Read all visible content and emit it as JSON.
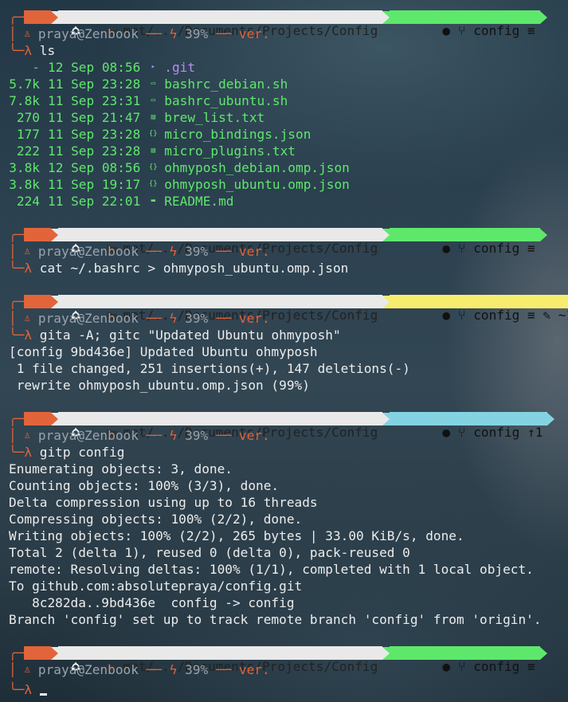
{
  "colors": {
    "accent_orange": "#e2643a",
    "git_clean": "#5ee86b",
    "git_dirty": "#f6ec6e",
    "git_ahead": "#84d3e3",
    "path_bg": "#e9e9e9",
    "file_green": "#5ee86b",
    "dir_purple": "#b98bf3"
  },
  "prompt": {
    "path": "mnt/.../Documents/Projects/Config",
    "user_host": "praya@Zenbook",
    "battery": "39%",
    "ver": "ver.",
    "lambda": "λ",
    "user_icon": "user-icon",
    "bolt_icon": "bolt-icon",
    "folder_icon": "folder-icon",
    "os_icon": "ubuntu-icon",
    "git_icon": "github-icon",
    "branch_icon": "branch-icon"
  },
  "blocks": [
    {
      "branch": "config",
      "status": "≡",
      "command": "ls"
    },
    {
      "branch": "config",
      "status": "≡",
      "command": "cat ~/.bashrc > ohmyposh_ubuntu.omp.json"
    },
    {
      "branch": "config",
      "status": "≡",
      "changes": "~1",
      "command": "gita -A; gitc \"Updated Ubuntu ohmyposh\""
    },
    {
      "branch": "config",
      "status": "↑1",
      "command": "gitp config"
    },
    {
      "branch": "config",
      "status": "≡",
      "command": ""
    }
  ],
  "ls_output": [
    {
      "size": "-",
      "date": "12 Sep 08:56",
      "icon": "folder-icon",
      "name": ".git"
    },
    {
      "size": "5.7k",
      "date": "11 Sep 23:28",
      "icon": "terminal-file-icon",
      "name": "bashrc_debian.sh"
    },
    {
      "size": "7.8k",
      "date": "11 Sep 23:31",
      "icon": "terminal-file-icon",
      "name": "bashrc_ubuntu.sh"
    },
    {
      "size": "270",
      "date": "11 Sep 21:47",
      "icon": "text-file-icon",
      "name": "brew_list.txt"
    },
    {
      "size": "177",
      "date": "11 Sep 23:28",
      "icon": "json-file-icon",
      "name": "micro_bindings.json"
    },
    {
      "size": "222",
      "date": "11 Sep 23:28",
      "icon": "text-file-icon",
      "name": "micro_plugins.txt"
    },
    {
      "size": "3.8k",
      "date": "12 Sep 08:56",
      "icon": "json-file-icon",
      "name": "ohmyposh_debian.omp.json"
    },
    {
      "size": "3.8k",
      "date": "11 Sep 19:17",
      "icon": "json-file-icon",
      "name": "ohmyposh_ubuntu.omp.json"
    },
    {
      "size": "224",
      "date": "11 Sep 22:01",
      "icon": "markdown-file-icon",
      "name": "README.md"
    }
  ],
  "commit_output": [
    "[config 9bd436e] Updated Ubuntu ohmyposh",
    " 1 file changed, 251 insertions(+), 147 deletions(-)",
    " rewrite ohmyposh_ubuntu.omp.json (99%)"
  ],
  "push_output": [
    "Enumerating objects: 3, done.",
    "Counting objects: 100% (3/3), done.",
    "Delta compression using up to 16 threads",
    "Compressing objects: 100% (2/2), done.",
    "Writing objects: 100% (2/2), 265 bytes | 33.00 KiB/s, done.",
    "Total 2 (delta 1), reused 0 (delta 0), pack-reused 0",
    "remote: Resolving deltas: 100% (1/1), completed with 1 local object.",
    "To github.com:absolutepraya/config.git",
    "   8c282da..9bd436e  config -> config",
    "Branch 'config' set up to track remote branch 'config' from 'origin'."
  ]
}
